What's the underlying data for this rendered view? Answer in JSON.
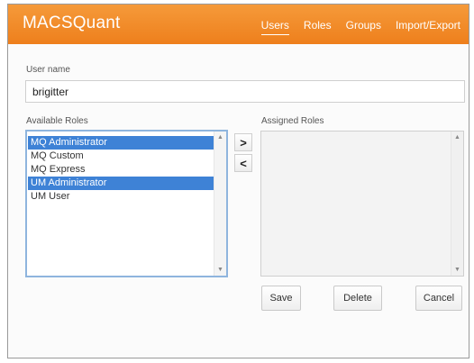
{
  "header": {
    "app_title": "MACSQuant",
    "nav": [
      {
        "label": "Users",
        "active": true
      },
      {
        "label": "Roles",
        "active": false
      },
      {
        "label": "Groups",
        "active": false
      },
      {
        "label": "Import/Export",
        "active": false
      }
    ],
    "background_color": "#f28c28"
  },
  "form": {
    "user_name_label": "User name",
    "user_name_value": "brigitter",
    "available_roles_label": "Available Roles",
    "assigned_roles_label": "Assigned Roles",
    "available_roles": [
      {
        "label": "MQ Administrator",
        "selected": true
      },
      {
        "label": "MQ Custom",
        "selected": false
      },
      {
        "label": "MQ Express",
        "selected": false
      },
      {
        "label": "UM Administrator",
        "selected": true
      },
      {
        "label": "UM User",
        "selected": false
      }
    ],
    "assigned_roles": [],
    "add_symbol": ">",
    "remove_symbol": "<",
    "selection_color": "#3e82d6"
  },
  "actions": {
    "save_label": "Save",
    "delete_label": "Delete",
    "cancel_label": "Cancel"
  }
}
